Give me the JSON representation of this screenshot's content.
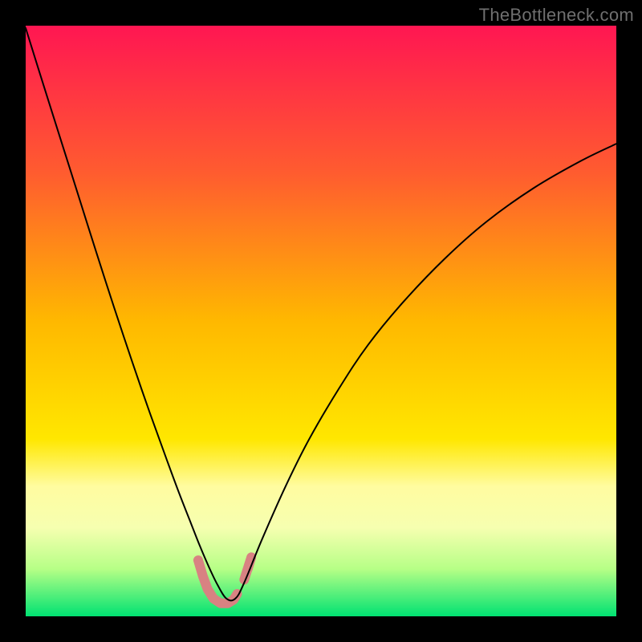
{
  "watermark": "TheBottleneck.com",
  "chart_data": {
    "type": "line",
    "title": "",
    "xlabel": "",
    "ylabel": "",
    "xlim": [
      0,
      100
    ],
    "ylim": [
      0,
      100
    ],
    "grid": false,
    "legend": false,
    "background_gradient": {
      "direction": "vertical",
      "stops": [
        {
          "offset": 0.0,
          "color": "#ff1652"
        },
        {
          "offset": 0.25,
          "color": "#ff5c2f"
        },
        {
          "offset": 0.5,
          "color": "#ffb800"
        },
        {
          "offset": 0.7,
          "color": "#ffe700"
        },
        {
          "offset": 0.78,
          "color": "#fffca0"
        },
        {
          "offset": 0.85,
          "color": "#f6ffb0"
        },
        {
          "offset": 0.92,
          "color": "#b6ff86"
        },
        {
          "offset": 1.0,
          "color": "#00e272"
        }
      ]
    },
    "series": [
      {
        "name": "bottleneck-curve",
        "color": "#000000",
        "stroke_width": 2,
        "x": [
          0,
          3,
          6,
          9,
          12,
          15,
          18,
          21,
          24,
          26,
          28,
          29.5,
          31,
          32.5,
          34,
          35.5,
          37,
          40,
          44,
          48,
          53,
          58,
          64,
          71,
          78,
          86,
          94,
          100
        ],
        "y": [
          99.6,
          90,
          80.5,
          71,
          61.5,
          52.2,
          43.2,
          34.5,
          26.2,
          20.8,
          15.7,
          11.9,
          8.4,
          5.3,
          3.0,
          3.0,
          5.7,
          13,
          22,
          30,
          38.5,
          46,
          53.3,
          60.6,
          66.8,
          72.5,
          77.1,
          80
        ]
      },
      {
        "name": "highlight-left-marker",
        "type": "marker-path",
        "color": "#d88282",
        "stroke_width": 12,
        "linecap": "round",
        "x": [
          29.2,
          30.0,
          30.8,
          31.8,
          33.0,
          34.2,
          35.2,
          35.8
        ],
        "y": [
          9.5,
          6.8,
          4.6,
          3.0,
          2.2,
          2.2,
          2.8,
          3.8
        ]
      },
      {
        "name": "highlight-right-marker",
        "type": "marker-path",
        "color": "#d88282",
        "stroke_width": 12,
        "linecap": "round",
        "x": [
          37.0,
          38.2,
          37.6
        ],
        "y": [
          6.2,
          10.0,
          8.0
        ]
      }
    ]
  }
}
